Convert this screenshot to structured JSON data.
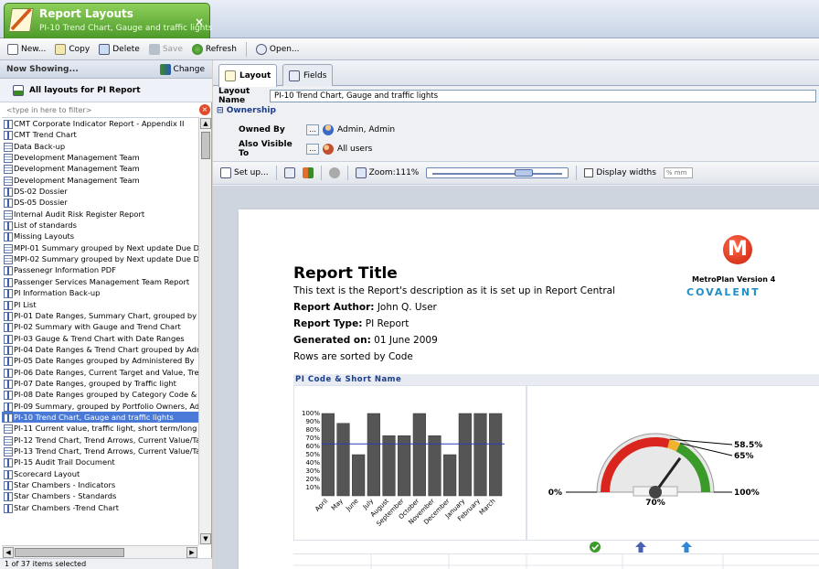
{
  "doc_tab": {
    "title": "Report Layouts",
    "subtitle": "PI-10 Trend Chart, Gauge and traffic lights",
    "close": "×"
  },
  "toolbar": {
    "new": "New...",
    "copy": "Copy",
    "delete": "Delete",
    "save": "Save",
    "refresh": "Refresh",
    "open": "Open..."
  },
  "left": {
    "now_showing": "Now Showing...",
    "change": "Change",
    "all_layouts": "All layouts for PI Report",
    "filter_placeholder": "<type in here to filter>",
    "status": "1 of 37 items selected",
    "items": [
      {
        "label": "CMT Corporate Indicator Report - Appendix II",
        "icon": "bar"
      },
      {
        "label": "CMT Trend Chart",
        "icon": "bar"
      },
      {
        "label": "Data Back-up",
        "icon": "grid"
      },
      {
        "label": "Development Management Team",
        "icon": "grid"
      },
      {
        "label": "Development Management Team",
        "icon": "grid"
      },
      {
        "label": "Development Management Team",
        "icon": "grid"
      },
      {
        "label": "DS-02 Dossier",
        "icon": "bar"
      },
      {
        "label": "DS-05 Dossier",
        "icon": "bar"
      },
      {
        "label": "Internal Audit Risk Register Report",
        "icon": "grid"
      },
      {
        "label": "List of standards",
        "icon": "bar"
      },
      {
        "label": "Missing Layouts",
        "icon": "bar"
      },
      {
        "label": "MPI-01 Summary grouped by Next update Due Dat",
        "icon": "grid"
      },
      {
        "label": "MPI-02 Summary grouped by Next update Due Dat",
        "icon": "grid"
      },
      {
        "label": "Passenegr Information PDF",
        "icon": "bar"
      },
      {
        "label": "Passenger Services Management Team Report",
        "icon": "bar"
      },
      {
        "label": "PI Information Back-up",
        "icon": "bar"
      },
      {
        "label": "PI List",
        "icon": "bar"
      },
      {
        "label": "PI-01 Date Ranges, Summary Chart, grouped by C",
        "icon": "bar"
      },
      {
        "label": "PI-02 Summary with Gauge and Trend Chart",
        "icon": "bar"
      },
      {
        "label": "PI-03 Gauge & Trend Chart with Date Ranges",
        "icon": "bar"
      },
      {
        "label": "PI-04 Date Ranges & Trend Chart grouped by Adm",
        "icon": "bar"
      },
      {
        "label": "PI-05 Date Ranges grouped by Administered By",
        "icon": "bar"
      },
      {
        "label": "PI-06 Date Ranges, Current Target and Value, Tre",
        "icon": "bar"
      },
      {
        "label": "PI-07 Date Ranges, grouped by Traffic light",
        "icon": "bar"
      },
      {
        "label": "PI-08 Date Ranges grouped by Category Code & D",
        "icon": "bar"
      },
      {
        "label": "PI-09 Summary, grouped by Portfolio Owners, Adm",
        "icon": "bar"
      },
      {
        "label": "PI-10 Trend Chart, Gauge and traffic lights",
        "icon": "bar",
        "selected": true
      },
      {
        "label": "PI-11 Current value, traffic light, short term/long te",
        "icon": "grid"
      },
      {
        "label": "PI-12 Trend Chart, Trend Arrows, Current Value/Ta",
        "icon": "grid"
      },
      {
        "label": "PI-13 Trend Chart, Trend Arrows, Current Value/Ta",
        "icon": "grid"
      },
      {
        "label": "PI-15 Audit Trail Document",
        "icon": "bar"
      },
      {
        "label": "Scorecard Layout",
        "icon": "bar"
      },
      {
        "label": "Star Chambers - Indicators",
        "icon": "bar"
      },
      {
        "label": "Star Chambers - Standards",
        "icon": "bar"
      },
      {
        "label": "Star Chambers -Trend Chart",
        "icon": "bar"
      }
    ]
  },
  "right": {
    "tab_layout": "Layout",
    "tab_fields": "Fields",
    "layout_name_label": "Layout Name",
    "layout_name_value": "PI-10 Trend Chart, Gauge and traffic lights",
    "ownership": "Ownership",
    "owned_by_label": "Owned By",
    "owned_by_value": "Admin, Admin",
    "visible_to_label": "Also Visible To",
    "visible_to_value": "All users",
    "dots": "...",
    "setup": "Set up...",
    "zoom": "Zoom:111%",
    "display_widths": "Display widths",
    "units_placeholder": "% mm"
  },
  "report": {
    "title": "Report Title",
    "description": "This text is the Report's description as it is set up in Report Central",
    "author_label": "Report Author:",
    "author": "John Q. User",
    "type_label": "Report Type:",
    "type": "PI Report",
    "generated_label": "Generated on:",
    "generated": "01 June 2009",
    "sorted": "Rows are sorted by Code",
    "logo_letter": "M",
    "product": "MetroPlan Version 4",
    "brand": "COVALENT",
    "section": "PI Code & Short Name"
  },
  "chart_data": [
    {
      "type": "bar",
      "title": "",
      "categories": [
        "April",
        "May",
        "June",
        "July",
        "August",
        "September",
        "October",
        "November",
        "December",
        "January",
        "February",
        "March"
      ],
      "values": [
        100,
        88,
        50,
        100,
        73,
        73,
        100,
        73,
        50,
        100,
        100,
        100
      ],
      "target_line": 63,
      "ylim": [
        0,
        100
      ],
      "yticks": [
        "100%",
        "90%",
        "80%",
        "70%",
        "60%",
        "50%",
        "40%",
        "30%",
        "20%",
        "10%"
      ],
      "bar_color": "#555555",
      "line_color": "#2a3fb8"
    },
    {
      "type": "gauge",
      "value": 70,
      "value_label": "70%",
      "min_label": "0%",
      "max_label": "100%",
      "thresholds": [
        58.5,
        65
      ],
      "threshold_labels": [
        "58.5%",
        "65%"
      ],
      "colors": {
        "red": "#d9251d",
        "amber": "#f2b230",
        "green": "#3a9a2a"
      }
    }
  ],
  "indicators": [
    {
      "icon": "green-check-icon",
      "color": "#3a9a2a"
    },
    {
      "icon": "up-arrow-icon",
      "color": "#4a5fb0"
    },
    {
      "icon": "up-arrow-icon",
      "color": "#2f86d6"
    }
  ]
}
